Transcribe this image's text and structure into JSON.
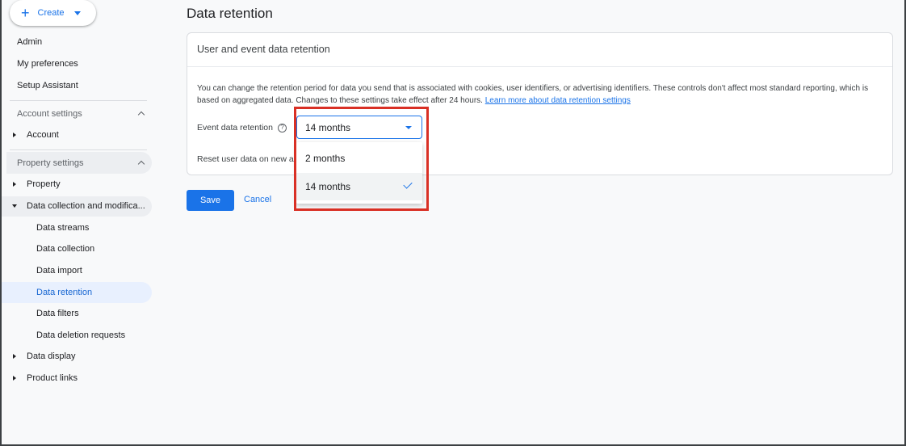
{
  "create": {
    "label": "Create",
    "icon": "plus-icon"
  },
  "nav_top": [
    {
      "label": "Admin"
    },
    {
      "label": "My preferences"
    },
    {
      "label": "Setup Assistant"
    }
  ],
  "account_settings": {
    "title": "Account settings",
    "items": [
      {
        "label": "Account"
      }
    ]
  },
  "property_settings": {
    "title": "Property settings",
    "property": "Property",
    "data_collection": "Data collection and modifica...",
    "sub_items": [
      {
        "label": "Data streams"
      },
      {
        "label": "Data collection"
      },
      {
        "label": "Data import"
      },
      {
        "label": "Data retention",
        "active": true
      },
      {
        "label": "Data filters"
      },
      {
        "label": "Data deletion requests"
      }
    ],
    "data_display": "Data display",
    "product_links": "Product links"
  },
  "main": {
    "title": "Data retention",
    "card_title": "User and event data retention",
    "description": "You can change the retention period for data you send that is associated with cookies, user identifiers, or advertising identifiers. These controls don't affect most standard reporting, which is based on aggregated data. Changes to these settings take effect after 24 hours.",
    "learn_more": "Learn more about data retention settings",
    "event_label": "Event data retention",
    "help_icon": "?",
    "reset_label": "Reset user data on new a",
    "select_value": "14 months",
    "options": [
      {
        "label": "2 months"
      },
      {
        "label": "14 months",
        "selected": true
      }
    ],
    "save": "Save",
    "cancel": "Cancel"
  },
  "colors": {
    "accent": "#1a73e8",
    "highlight": "#d93025"
  }
}
